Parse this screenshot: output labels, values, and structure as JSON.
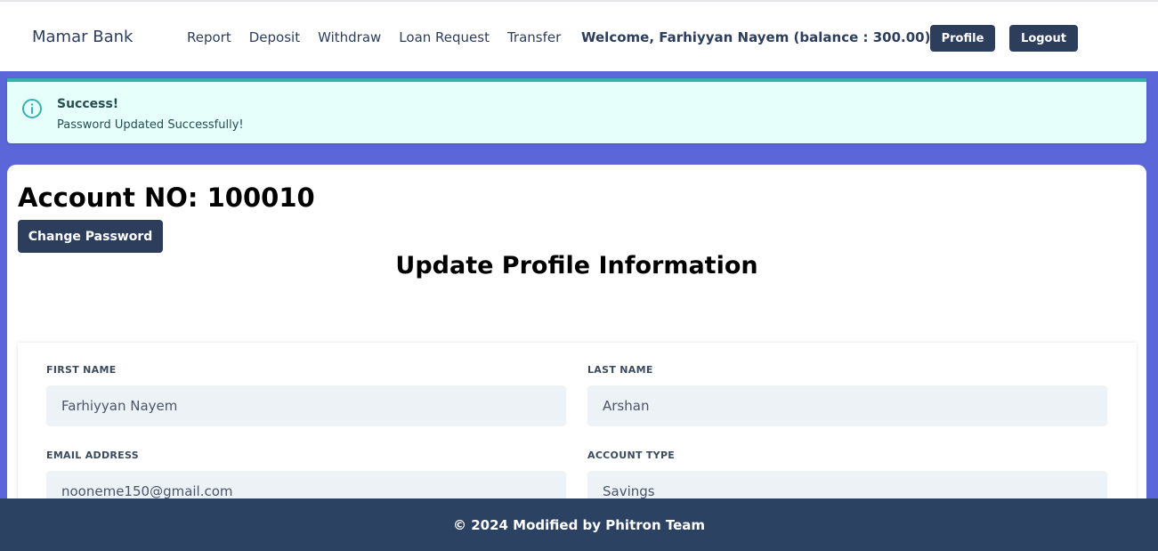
{
  "nav": {
    "brand": "Mamar Bank",
    "links": [
      "Report",
      "Deposit",
      "Withdraw",
      "Loan Request",
      "Transfer"
    ],
    "welcome": "Welcome, Farhiyyan Nayem (balance : 300.00)",
    "profile_label": "Profile",
    "logout_label": "Logout"
  },
  "alert": {
    "icon": "info-circle-icon",
    "title": "Success!",
    "message": "Password Updated Successfully!",
    "color": "#38b2ac"
  },
  "account": {
    "title": "Account NO: 100010",
    "change_password_label": "Change Password"
  },
  "form": {
    "title": "Update Profile Information",
    "first_name_label": "FIRST NAME",
    "first_name_value": "Farhiyyan Nayem",
    "last_name_label": "LAST NAME",
    "last_name_value": "Arshan",
    "email_label": "EMAIL ADDRESS",
    "email_value": "nooneme150@gmail.com",
    "account_type_label": "ACCOUNT TYPE",
    "account_type_value": "Savings"
  },
  "footer": {
    "text": "© 2024 Modified by Phitron Team"
  },
  "colors": {
    "primary": "#2c3e5c",
    "background": "#5b67d9",
    "alert_bg": "#e6fffb"
  }
}
